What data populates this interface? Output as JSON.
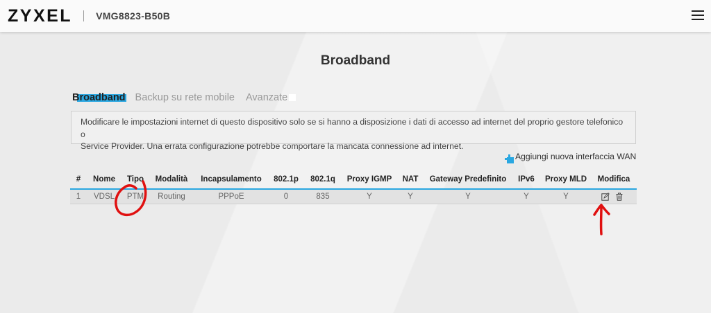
{
  "header": {
    "logo": "ZYXEL",
    "model": "VMG8823-B50B",
    "menu_icon": "hamburger-menu-icon"
  },
  "page": {
    "title": "Broadband"
  },
  "tabs": [
    {
      "label": "Broadband",
      "active": true
    },
    {
      "label": "Backup su rete mobile",
      "active": false
    },
    {
      "label": "Avanzate",
      "active": false
    }
  ],
  "info": {
    "line1": "Modificare le impostazioni internet di questo dispositivo solo se si hanno a disposizione i dati di accesso ad internet del proprio gestore telefonico o",
    "line2": "Service Provider. Una errata configurazione potrebbe comportare la mancata connessione ad internet."
  },
  "add_wan": {
    "label": "Aggiungi nuova interfaccia WAN",
    "icon": "plus-icon"
  },
  "table": {
    "columns": [
      "#",
      "Nome",
      "Tipo",
      "Modalità",
      "Incapsulamento",
      "802.1p",
      "802.1q",
      "Proxy IGMP",
      "NAT",
      "Gateway Predefinito",
      "IPv6",
      "Proxy MLD",
      "Modifica"
    ],
    "rows": [
      {
        "cells": [
          "1",
          "VDSL",
          "PTM",
          "Routing",
          "PPPoE",
          "0",
          "835",
          "Y",
          "Y",
          "Y",
          "Y",
          "Y"
        ],
        "actions": [
          "edit-icon",
          "trash-icon"
        ]
      }
    ]
  },
  "colors": {
    "accent": "#29a7e1",
    "annotation": "#e01010"
  }
}
